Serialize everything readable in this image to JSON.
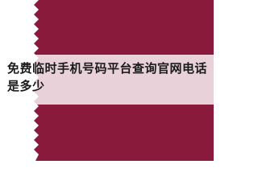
{
  "article": {
    "title": "免费临时手机号码平台查询官网电话是多少"
  },
  "background": {
    "image": "qatar-flag",
    "colors": {
      "maroon": "#8a1a3c",
      "white": "#ffffff"
    }
  }
}
